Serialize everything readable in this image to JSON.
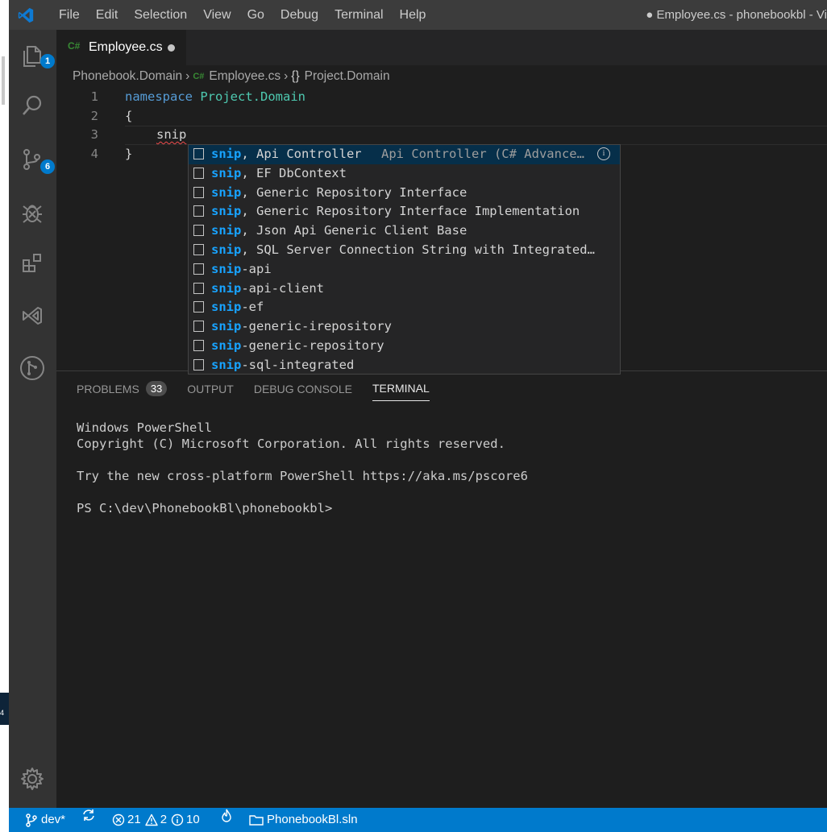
{
  "menu": [
    "File",
    "Edit",
    "Selection",
    "View",
    "Go",
    "Debug",
    "Terminal",
    "Help"
  ],
  "window_title": "● Employee.cs - phonebookbl - Vi",
  "left_strip_label": "4",
  "activity": {
    "explorer_badge": "1",
    "scm_badge": "6"
  },
  "tab": {
    "lang": "C#",
    "name": "Employee.cs"
  },
  "breadcrumb": {
    "project": "Phonebook.Domain",
    "lang": "C#",
    "file": "Employee.cs",
    "ns_icon": "{}",
    "namespace": "Project.Domain"
  },
  "editor": {
    "line_numbers": [
      "1",
      "2",
      "3",
      "4"
    ],
    "keyword": "namespace",
    "namespace_name": "Project.Domain",
    "open_brace": "{",
    "typed": "snip",
    "close_brace": "}"
  },
  "suggestions": {
    "match": "snip",
    "items": [
      {
        "rest": ", Api Controller",
        "detail": "Api Controller (C# Advance…"
      },
      {
        "rest": ", EF DbContext"
      },
      {
        "rest": ", Generic Repository Interface"
      },
      {
        "rest": ", Generic Repository Interface Implementation"
      },
      {
        "rest": ", Json Api Generic Client Base"
      },
      {
        "rest": ", SQL Server Connection String with Integrated…"
      },
      {
        "rest": "-api"
      },
      {
        "rest": "-api-client"
      },
      {
        "rest": "-ef"
      },
      {
        "rest": "-generic-irepository"
      },
      {
        "rest": "-generic-repository"
      },
      {
        "rest": "-sql-integrated"
      }
    ]
  },
  "panel": {
    "problems": "PROBLEMS",
    "problems_count": "33",
    "output": "OUTPUT",
    "debug_console": "DEBUG CONSOLE",
    "terminal": "TERMINAL"
  },
  "terminal": {
    "line1": "Windows PowerShell",
    "line2": "Copyright (C) Microsoft Corporation. All rights reserved.",
    "line3": "Try the new cross-platform PowerShell https://aka.ms/pscore6",
    "line4": "PS C:\\dev\\PhonebookBl\\phonebookbl>"
  },
  "status": {
    "branch": "dev*",
    "errors": "21",
    "warnings": "2",
    "infos": "10",
    "solution": "PhonebookBl.sln"
  },
  "colors": {
    "statusbar": "#007acc",
    "activitybar": "#333333",
    "editor_bg": "#1e1e1e",
    "match_highlight": "#18a3ff"
  }
}
